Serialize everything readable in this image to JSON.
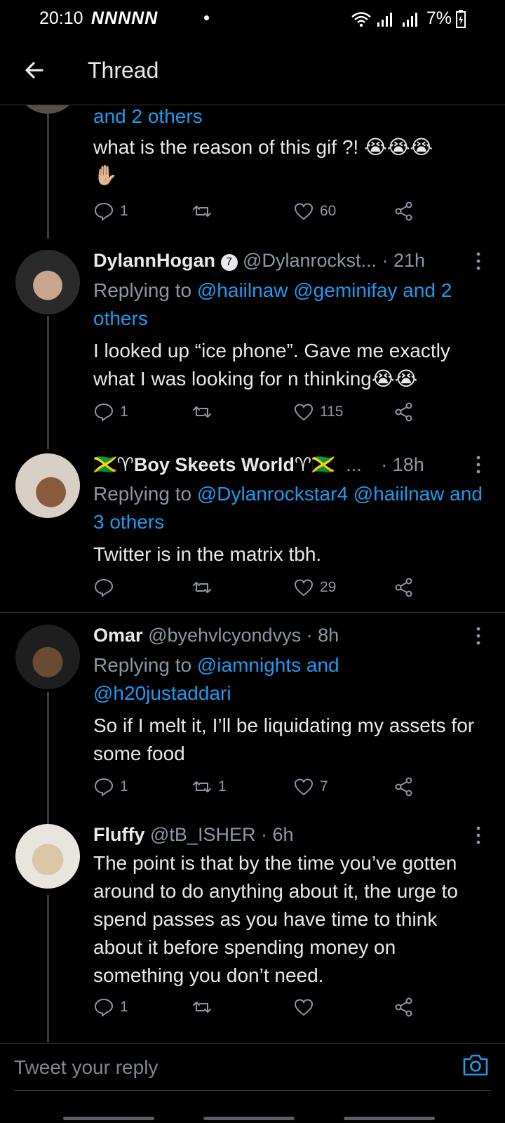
{
  "status": {
    "time": "20:10",
    "notification_icons": "NNNNN",
    "dot": "•",
    "battery": "7%"
  },
  "header": {
    "title": "Thread"
  },
  "colors": {
    "accent": "#1d9bf0",
    "muted": "#8b98a5",
    "bg": "#000000"
  },
  "tweets": [
    {
      "reply_tail": "and 2 others",
      "text": "what is the reason of this gif ?! 😭😭😭",
      "text2": "✋🏼",
      "replies": "1",
      "retweets": "",
      "likes": "60"
    },
    {
      "name": "DylannHogan",
      "badge": "7",
      "handle": "@Dylanrockst...",
      "time": "· 21h",
      "reply_prefix": "Replying to ",
      "reply_targets": "@haiilnaw @geminifay and 2 others",
      "text": "I looked up “ice phone”. Gave me exactly what I was looking for n thinking😭😭",
      "replies": "1",
      "retweets": "",
      "likes": "115"
    },
    {
      "name": "🇯🇲♈Boy Skeets World♈🇯🇲",
      "handle": "...",
      "time": "· 18h",
      "reply_prefix": "Replying to ",
      "reply_targets": "@Dylanrockstar4 @haiilnaw and 3 others",
      "text": "Twitter is in the matrix tbh.",
      "replies": "",
      "retweets": "",
      "likes": "29"
    },
    {
      "name": "Omar",
      "handle": "@byehvlcyondvys",
      "time": "· 8h",
      "reply_prefix": "Replying to ",
      "reply_targets": "@iamnights and @h20justaddari",
      "text": "So if I melt it, I’ll be liquidating my assets for some food",
      "replies": "1",
      "retweets": "1",
      "likes": "7"
    },
    {
      "name": "Fluffy",
      "handle": "@tB_ISHER",
      "time": "· 6h",
      "text": "The point is that by the time you’ve gotten around to do anything about it, the urge to spend passes as you have time to think about it before spending money on something you don’t need.",
      "replies": "1",
      "retweets": "",
      "likes": ""
    }
  ],
  "composer": {
    "placeholder": "Tweet your reply"
  }
}
